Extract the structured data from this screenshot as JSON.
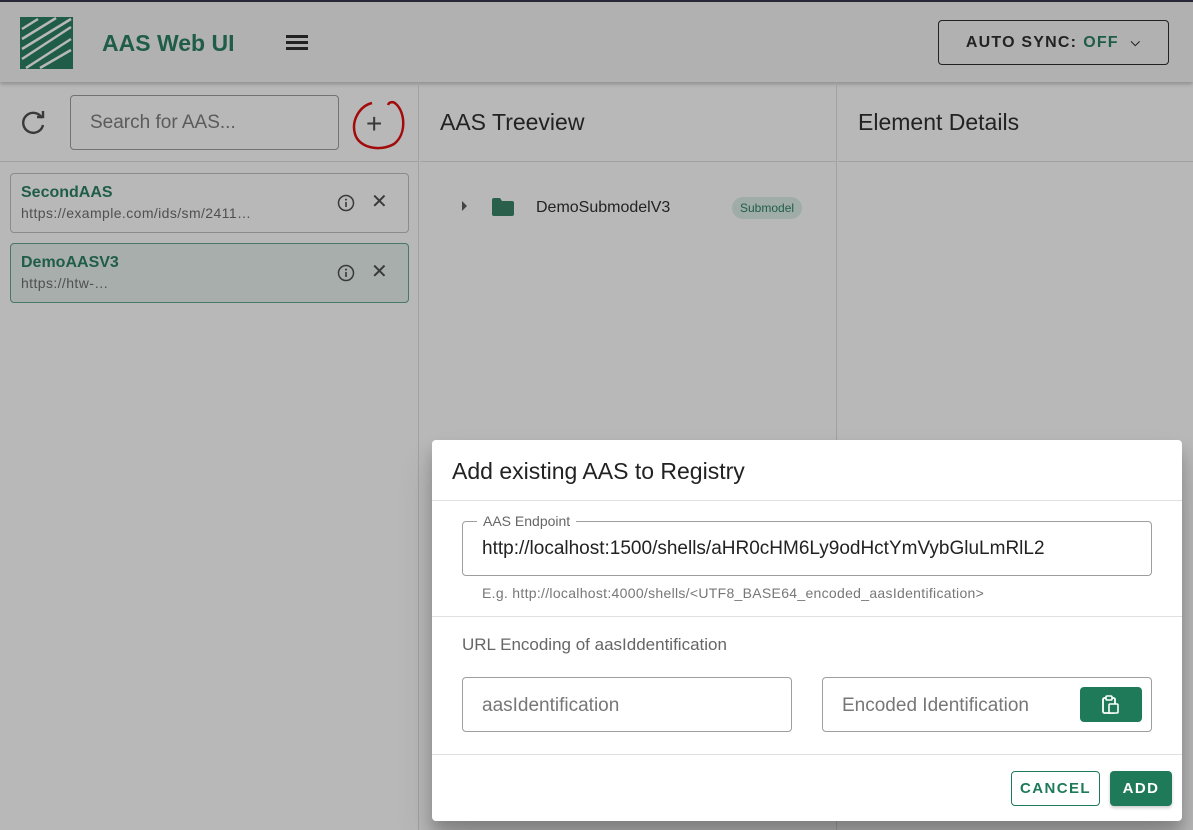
{
  "app": {
    "title": "AAS Web UI",
    "auto_sync_label": "AUTO SYNC:",
    "auto_sync_value": "OFF",
    "accent_color": "#1f7a5a"
  },
  "left_panel": {
    "search_placeholder": "Search for AAS...",
    "items": [
      {
        "name": "SecondAAS",
        "url": "https://example.com/ids/sm/2411…"
      },
      {
        "name": "DemoAASV3",
        "url": "https://htw-…"
      }
    ],
    "icons": [
      "refresh-icon",
      "add-icon",
      "info-icon",
      "close-icon"
    ]
  },
  "treeview": {
    "title": "AAS Treeview",
    "nodes": [
      {
        "label": "DemoSubmodelV3",
        "chip": "Submodel"
      }
    ]
  },
  "details": {
    "title": "Element Details"
  },
  "dialog": {
    "title": "Add existing AAS to Registry",
    "endpoint_label": "AAS Endpoint",
    "endpoint_value": "http://localhost:1500/shells/aHR0cHM6Ly9odHctYmVybGluLmRlL2",
    "endpoint_hint": "E.g. http://localhost:4000/shells/<UTF8_BASE64_encoded_aasIdentification>",
    "encoding_label": "URL Encoding of aasIddentification",
    "aas_id_placeholder": "aasIdentification",
    "encoded_placeholder": "Encoded Identification",
    "cancel_label": "CANCEL",
    "add_label": "ADD"
  }
}
